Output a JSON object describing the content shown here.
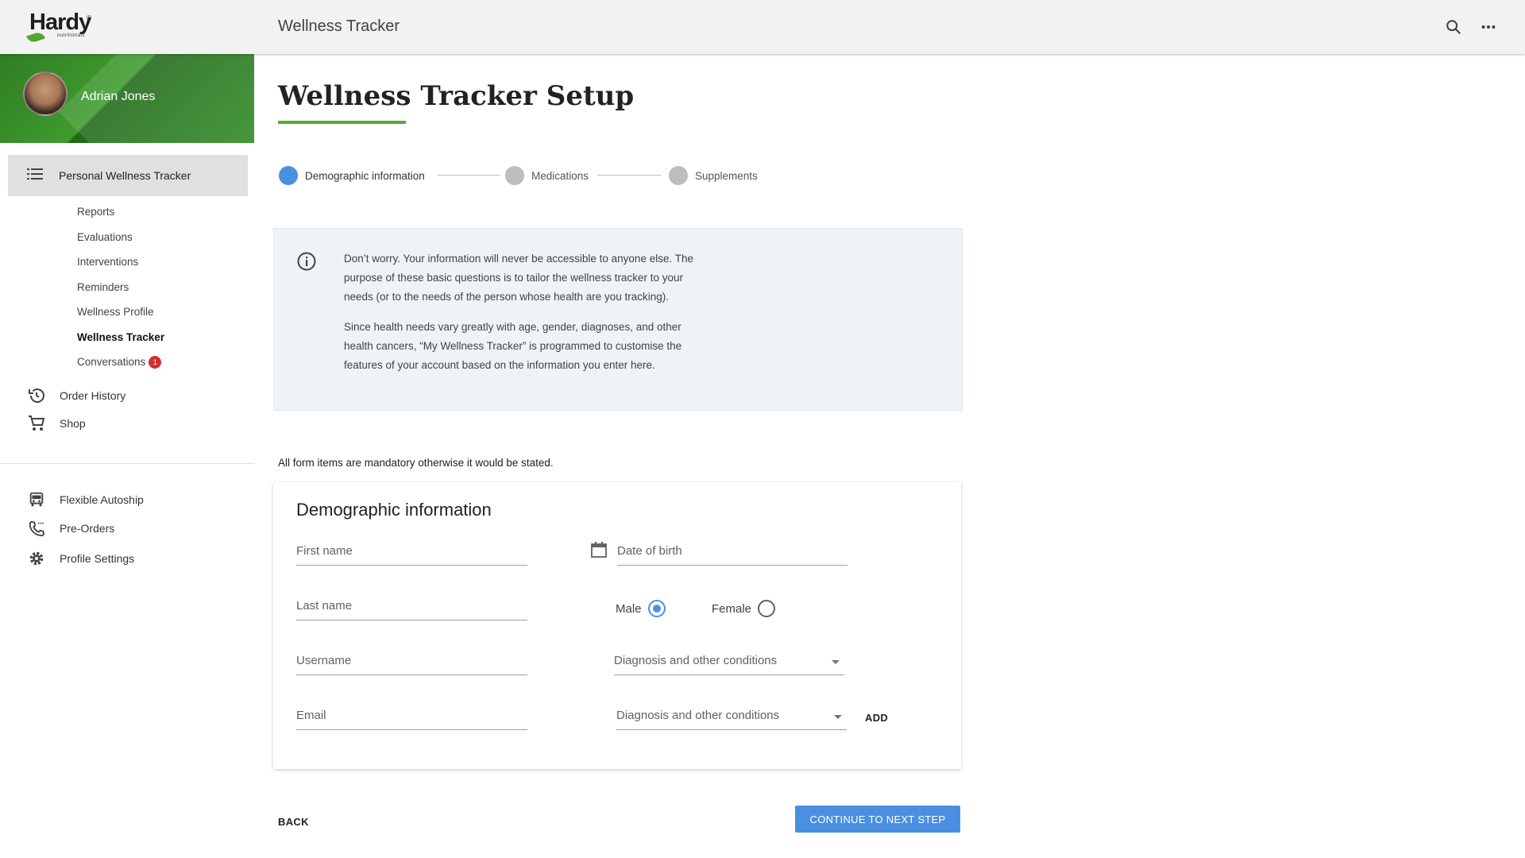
{
  "brand": {
    "logo_text": "Hardy",
    "logo_sub": "nutritionals",
    "logo_reg": "®"
  },
  "header": {
    "title": "Wellness Tracker"
  },
  "user": {
    "name": "Adrian Jones"
  },
  "sidebar": {
    "active_section": "Personal Wellness Tracker",
    "sub_items": [
      {
        "label": "Reports"
      },
      {
        "label": "Evaluations"
      },
      {
        "label": "Interventions"
      },
      {
        "label": "Reminders"
      },
      {
        "label": "Wellness Profile"
      },
      {
        "label": "Wellness Tracker",
        "active": true
      },
      {
        "label": "Conversations",
        "badge": "1"
      }
    ],
    "primary_items": [
      {
        "label": "Order History",
        "icon": "history-icon"
      },
      {
        "label": "Shop",
        "icon": "cart-icon"
      }
    ],
    "secondary_items": [
      {
        "label": "Flexible Autoship",
        "icon": "car-icon"
      },
      {
        "label": "Pre-Orders",
        "icon": "phone-icon"
      },
      {
        "label": "Profile Settings",
        "icon": "gear-icon"
      }
    ]
  },
  "main": {
    "page_title": "Wellness Tracker Setup",
    "steps": [
      {
        "label": "Demographic information",
        "state": "active"
      },
      {
        "label": "Medications",
        "state": "inactive"
      },
      {
        "label": "Supplements",
        "state": "inactive"
      }
    ],
    "info": {
      "paragraph1": "Don’t worry. Your information will never be accessible to anyone else. The purpose of these basic questions is to tailor the wellness tracker to your needs (or to the needs of the person whose health are you tracking).",
      "paragraph2": "Since health needs vary greatly with age, gender, diagnoses, and other health cancers, “My Wellness Tracker” is programmed to customise the features of your account based on the information you enter here."
    },
    "mandatory_note": "All form items are mandatory otherwise it would be stated.",
    "form": {
      "title": "Demographic information",
      "first_name_placeholder": "First name",
      "last_name_placeholder": "Last name",
      "username_placeholder": "Username",
      "email_placeholder": "Email",
      "dob_placeholder": "Date of birth",
      "gender_options": [
        {
          "label": "Male",
          "selected": true
        },
        {
          "label": "Female",
          "selected": false
        }
      ],
      "diagnosis1_placeholder": "Diagnosis and other conditions",
      "diagnosis2_placeholder": "Diagnosis and other conditions",
      "add_label": "ADD"
    },
    "back_label": "BACK",
    "next_label": "CONTINUE TO NEXT STEP"
  },
  "colors": {
    "accent": "#4a90e2",
    "brand_green": "#5aa832",
    "info_bg": "#eef3f6",
    "badge": "#d32f2f"
  }
}
